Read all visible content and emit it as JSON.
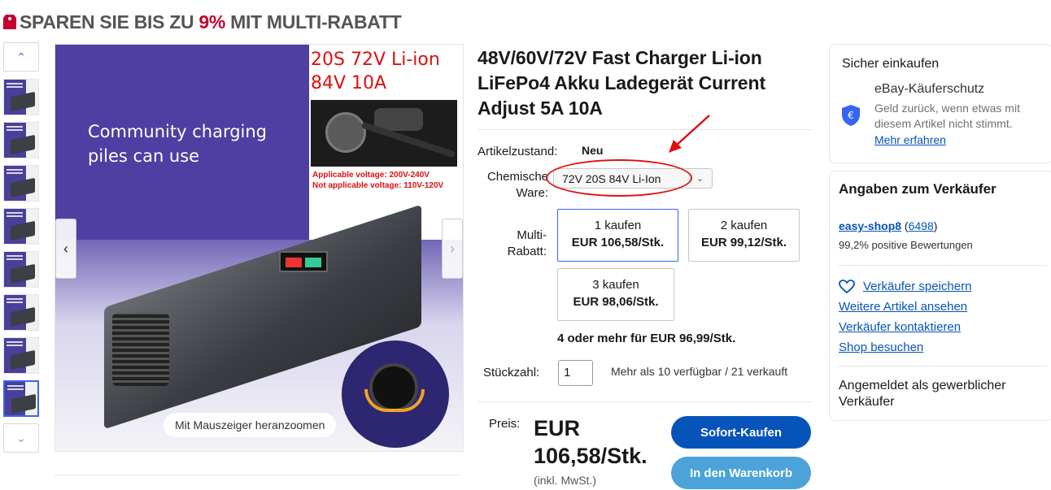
{
  "banner": {
    "prefix": "SPAREN SIE BIS ZU ",
    "percent": "9%",
    "suffix": " MIT MULTI-RABATT",
    "accent_color": "#c3002f"
  },
  "gallery": {
    "thumb_count": 8,
    "active_index": 8,
    "image_text": {
      "community": "Community charging piles can use",
      "spec_line1": "20S 72V Li-ion",
      "spec_line2": "84V 10A",
      "applicable": "Applicable voltage: 200V-240V",
      "not_applicable": "Not applicable voltage: 110V-120V"
    },
    "zoom_hint": "Mit Mauszeiger heranzoomen"
  },
  "product": {
    "title": "48V/60V/72V Fast Charger Li-ion LiFePo4 Akku Ladegerät Current Adjust 5A 10A",
    "condition_label": "Artikelzustand:",
    "condition_value": "Neu",
    "variant_label": "Chemische Ware:",
    "variant_value": "72V 20S 84V Li-Ion",
    "multi_label": "Multi-Rabatt:",
    "tiers": [
      {
        "qty": "1 kaufen",
        "price": "EUR 106,58/Stk."
      },
      {
        "qty": "2 kaufen",
        "price": "EUR 99,12/Stk."
      },
      {
        "qty": "3 kaufen",
        "price": "EUR 98,06/Stk."
      }
    ],
    "four_more": "4 oder mehr für EUR 96,99/Stk.",
    "quantity_label": "Stückzahl:",
    "quantity_value": "1",
    "availability": "Mehr als 10 verfügbar / 21 verkauft",
    "price_label": "Preis:",
    "price_line1": "EUR",
    "price_line2": "106,58/Stk.",
    "price_note": "(inkl. MwSt.)",
    "buy_now": "Sofort-Kaufen",
    "add_to_cart": "In den Warenkorb"
  },
  "safe_shopping": {
    "heading": "Sicher einkaufen",
    "protection_title": "eBay-Käuferschutz",
    "protection_desc": "Geld zurück, wenn etwas mit diesem Artikel nicht stimmt.",
    "learn_more": "Mehr erfahren",
    "icon": "shield-euro-icon"
  },
  "seller": {
    "heading": "Angaben zum Verkäufer",
    "name": "easy-shop8",
    "rating_open": " (",
    "rating_count": "6498",
    "rating_close": ")",
    "positive": "99,2% positive Bewertungen",
    "save": "Verkäufer speichern",
    "more_items": "Weitere Artikel ansehen",
    "contact": "Verkäufer kontaktieren",
    "shop": "Shop besuchen",
    "business": "Angemeldet als gewerblicher Verkäufer"
  }
}
